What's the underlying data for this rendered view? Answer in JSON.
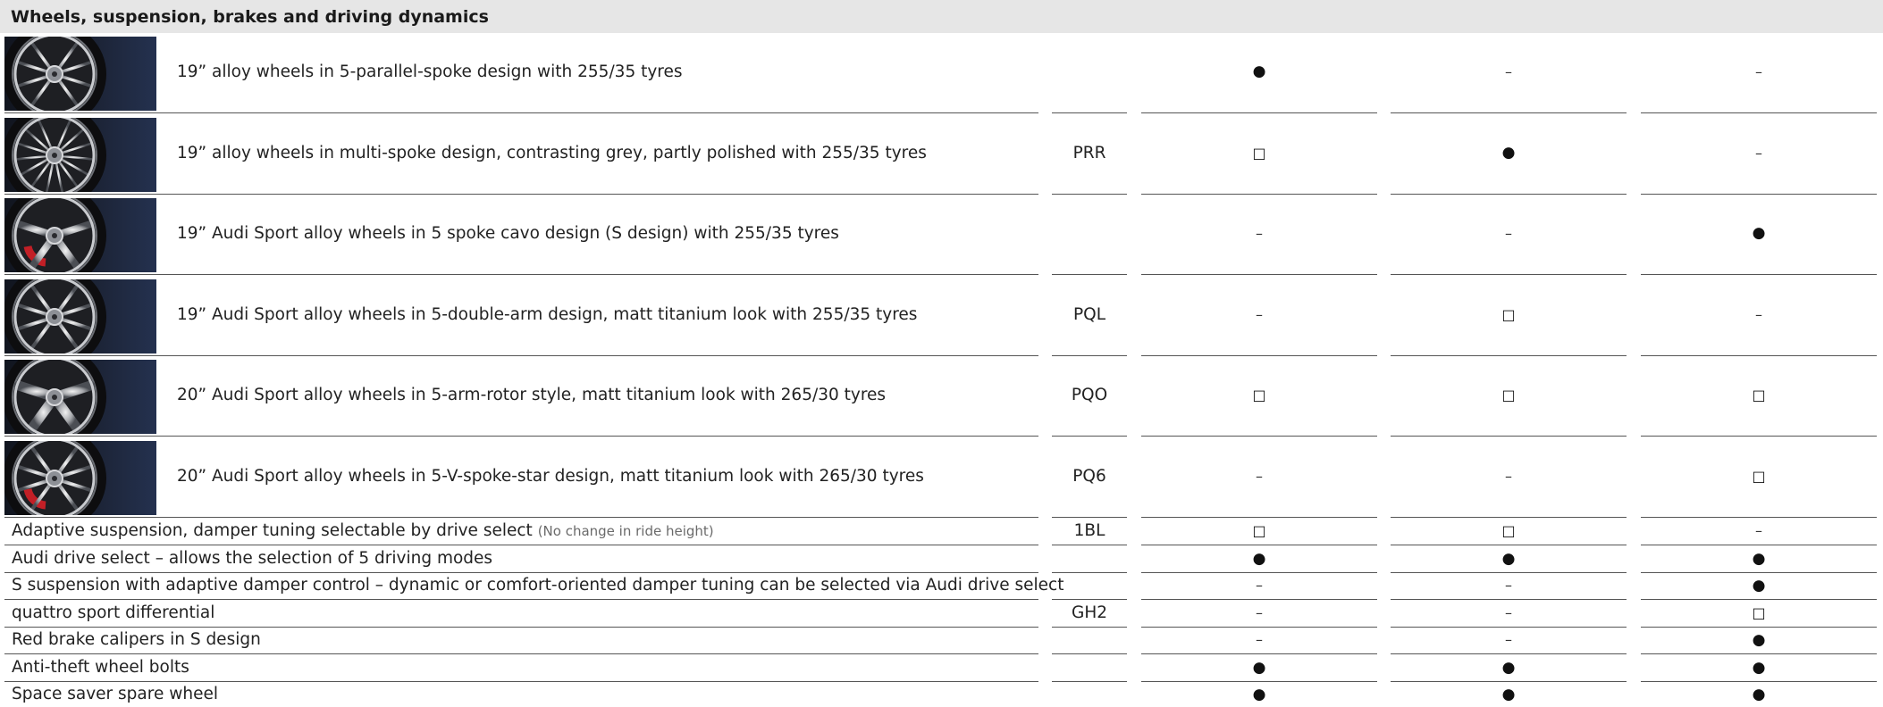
{
  "section": {
    "title": "Wheels, suspension, brakes and driving dynamics"
  },
  "symbols": {
    "standard": "●",
    "optional": "□",
    "not_available": "–"
  },
  "wheel_rows": [
    {
      "label": "19” alloy wheels in 5-parallel-spoke design with 255/35 tyres",
      "code": "",
      "values": [
        "●",
        "–",
        "–"
      ],
      "thumb": "5-parallel-spoke"
    },
    {
      "label": "19” alloy wheels in multi-spoke design, contrasting grey, partly polished with 255/35 tyres",
      "code": "PRR",
      "values": [
        "□",
        "●",
        "–"
      ],
      "thumb": "multi-spoke"
    },
    {
      "label": "19” Audi Sport alloy wheels in 5 spoke cavo design (S design) with 255/35 tyres",
      "code": "",
      "values": [
        "–",
        "–",
        "●"
      ],
      "thumb": "5-spoke-cavo"
    },
    {
      "label": "19” Audi Sport alloy wheels in 5-double-arm design, matt titanium look with 255/35 tyres",
      "code": "PQL",
      "values": [
        "–",
        "□",
        "–"
      ],
      "thumb": "5-double-arm"
    },
    {
      "label": "20” Audi Sport alloy wheels in 5-arm-rotor style, matt titanium look with 265/30 tyres",
      "code": "PQO",
      "values": [
        "□",
        "□",
        "□"
      ],
      "thumb": "5-arm-rotor"
    },
    {
      "label": "20” Audi Sport alloy wheels in 5-V-spoke-star design, matt titanium look with 265/30 tyres",
      "code": "PQ6",
      "values": [
        "–",
        "–",
        "□"
      ],
      "thumb": "5-v-spoke-star"
    }
  ],
  "plain_rows": [
    {
      "label": "Adaptive suspension, damper tuning selectable by drive select",
      "note": "(No change in ride height)",
      "code": "1BL",
      "values": [
        "□",
        "□",
        "–"
      ]
    },
    {
      "label": "Audi drive select – allows the selection of 5 driving modes",
      "note": "",
      "code": "",
      "values": [
        "●",
        "●",
        "●"
      ]
    },
    {
      "label": "S suspension with adaptive damper control – dynamic or comfort-oriented damper tuning can be selected via Audi drive select",
      "note": "",
      "code": "",
      "values": [
        "–",
        "–",
        "●"
      ]
    },
    {
      "label": "quattro sport differential",
      "note": "",
      "code": "GH2",
      "values": [
        "–",
        "–",
        "□"
      ]
    },
    {
      "label": "Red brake calipers in S design",
      "note": "",
      "code": "",
      "values": [
        "–",
        "–",
        "●"
      ]
    },
    {
      "label": "Anti-theft wheel bolts",
      "note": "",
      "code": "",
      "values": [
        "●",
        "●",
        "●"
      ]
    },
    {
      "label": "Space saver spare wheel",
      "note": "",
      "code": "",
      "values": [
        "●",
        "●",
        "●"
      ]
    }
  ]
}
